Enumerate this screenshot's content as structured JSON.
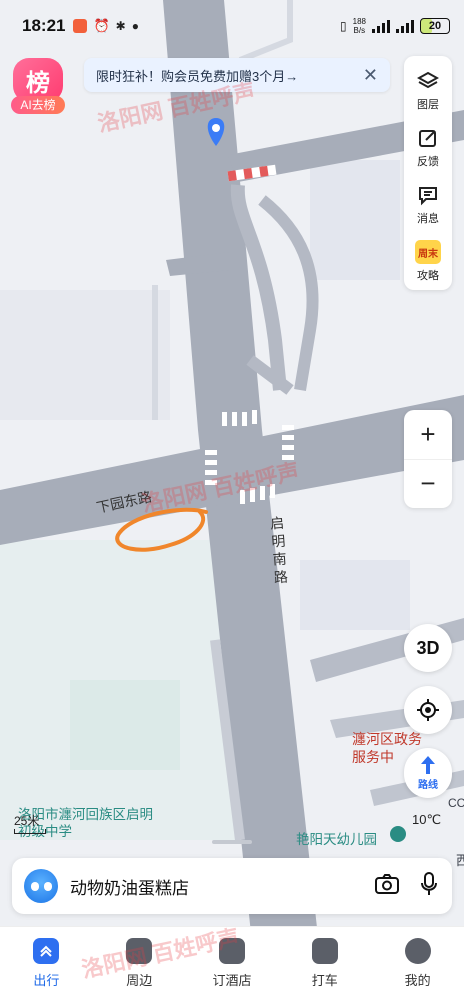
{
  "status_bar": {
    "time": "18:21",
    "net_speed": "188",
    "net_unit": "B/s",
    "battery": "20"
  },
  "ai_badge": {
    "icon_char": "榜",
    "label": "AI去榜"
  },
  "promo": {
    "text": "限时狂补！购会员免费加赠3个月→",
    "close": "✕"
  },
  "tools": [
    {
      "name": "layers",
      "label": "图层"
    },
    {
      "name": "feedback",
      "label": "反馈"
    },
    {
      "name": "messages",
      "label": "消息"
    },
    {
      "name": "weekend-guide",
      "label": "攻略",
      "badge": "周末"
    }
  ],
  "zoom": {
    "in": "+",
    "out": "−"
  },
  "view_3d": "3D",
  "route_label": "路线",
  "map_labels": {
    "xiayuan_east_road": "下园东路",
    "qiming_south_road": "启明南路",
    "government": "瀍河区政务服务中",
    "school": "洛阳市瀍河回族区启明初级中学",
    "kindergarten": "艳阳天幼儿园",
    "temperature": "10℃",
    "co_label": "CC",
    "west_label": "西"
  },
  "scale": "25米",
  "search": {
    "text": "动物奶油蛋糕店"
  },
  "bottom_nav": [
    {
      "name": "travel",
      "label": "出行",
      "active": true
    },
    {
      "name": "nearby",
      "label": "周边",
      "active": false
    },
    {
      "name": "hotel",
      "label": "订酒店",
      "active": false
    },
    {
      "name": "taxi",
      "label": "打车",
      "active": false
    },
    {
      "name": "mine",
      "label": "我的",
      "active": false
    }
  ],
  "watermark": {
    "cn": "洛阳网",
    "tag": "百姓呼声"
  },
  "colors": {
    "accent": "#1f6ae8",
    "road": "#a7adb9",
    "map_bg": "#eef0f4",
    "annotation": "#f0862b"
  }
}
